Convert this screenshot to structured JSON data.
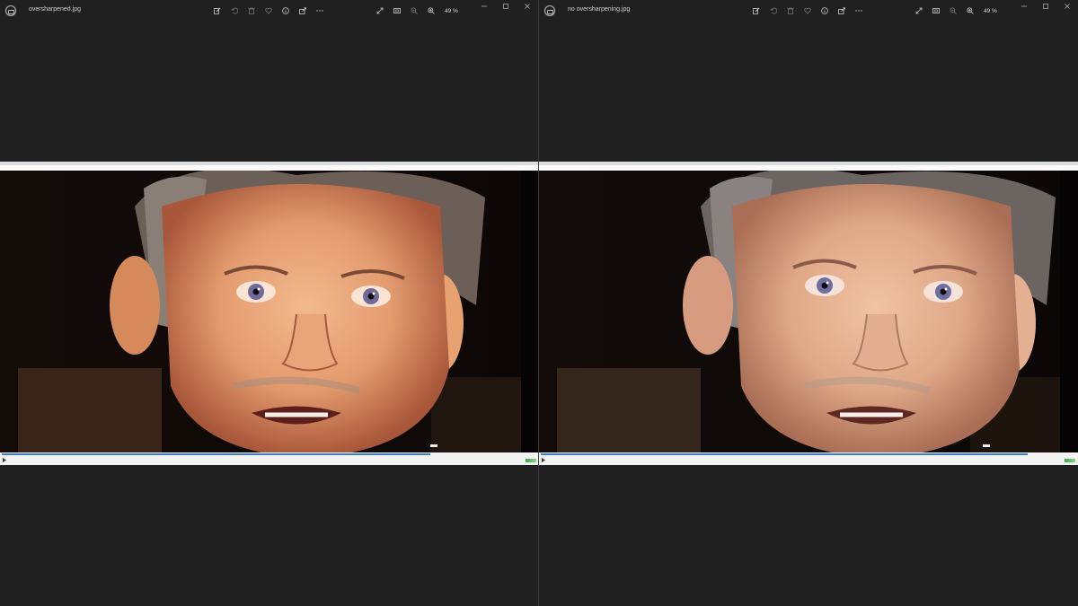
{
  "viewers": [
    {
      "filename": "oversharpened.jpg",
      "zoom": "49 %",
      "video_progress": 0.8,
      "variant": "sharp"
    },
    {
      "filename": "no oversharpening.jpg",
      "zoom": "49 %",
      "video_progress": 0.91,
      "variant": "smooth"
    }
  ],
  "toolbar_icons": [
    "edit-icon",
    "rotate-icon",
    "delete-icon",
    "favorite-icon",
    "info-icon",
    "share-icon",
    "more-icon"
  ],
  "zoom_icons": [
    "fullscreen-icon",
    "fit-icon",
    "zoom-out-icon",
    "zoom-in-icon"
  ],
  "window_icons": [
    "minimize-icon",
    "maximize-icon",
    "close-icon"
  ],
  "colors": {
    "background": "#202020",
    "seek_fill": "#3b7fd4"
  }
}
